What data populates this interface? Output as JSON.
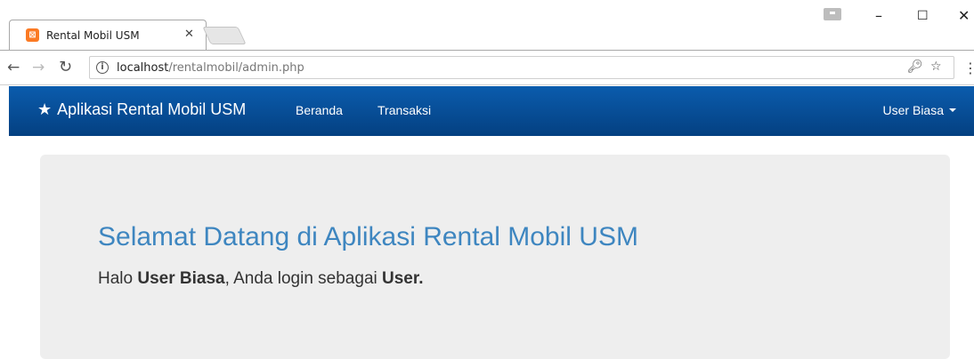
{
  "browser": {
    "tab_title": "Rental Mobil USM",
    "favicon_glyph": "⊠",
    "url_host": "localhost",
    "url_path": "/rentalmobil/admin.php",
    "icons": {
      "back": "arrow-left-icon",
      "forward": "arrow-right-icon",
      "reload": "reload-icon",
      "info": "info-icon",
      "key": "key-icon",
      "star": "star-icon",
      "menu": "menu-dots-icon"
    }
  },
  "navbar": {
    "brand": "Aplikasi Rental Mobil USM",
    "links": [
      "Beranda",
      "Transaksi"
    ],
    "user": "User Biasa",
    "colors": {
      "top": "#0b5cad",
      "bottom": "#044081"
    }
  },
  "jumbotron": {
    "title": "Selamat Datang di Aplikasi Rental Mobil USM",
    "greeting_prefix": "Halo ",
    "user_name": "User Biasa",
    "greeting_middle": ", Anda login sebagai ",
    "role": "User.",
    "title_color": "#3e86c0"
  }
}
